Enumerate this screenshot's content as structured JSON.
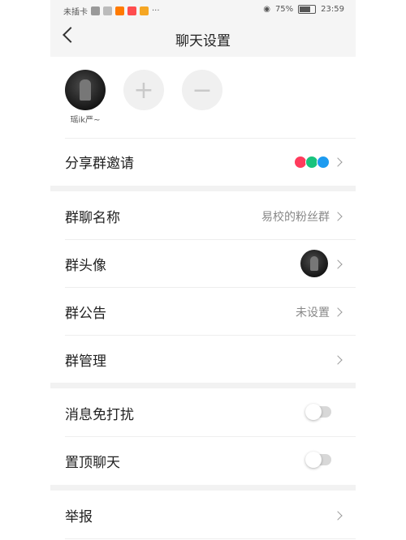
{
  "status_bar": {
    "carrier": "未插卡",
    "battery_pct": "75%",
    "time": "23:59"
  },
  "header": {
    "title": "聊天设置"
  },
  "members": [
    {
      "name": "瑶ik严~"
    }
  ],
  "share": {
    "label": "分享群邀请"
  },
  "group_name": {
    "label": "群聊名称",
    "value": "易校的粉丝群"
  },
  "group_avatar": {
    "label": "群头像"
  },
  "announcement": {
    "label": "群公告",
    "value": "未设置"
  },
  "management": {
    "label": "群管理"
  },
  "dnd": {
    "label": "消息免打扰",
    "enabled": false
  },
  "pin": {
    "label": "置顶聊天",
    "enabled": false
  },
  "report": {
    "label": "举报"
  },
  "colors": {
    "share_icon_1": "#ff3b5c",
    "share_icon_2": "#19c37d",
    "share_icon_3": "#1d9bf0",
    "toggle_off": "#d8d8d8"
  }
}
